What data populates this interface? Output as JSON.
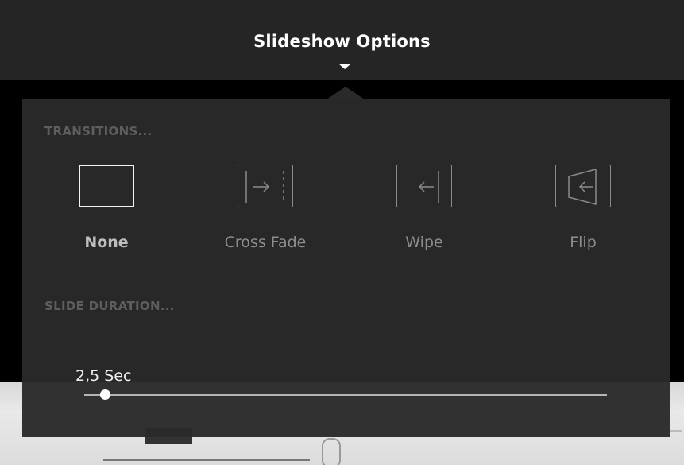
{
  "header": {
    "title": "Slideshow Options"
  },
  "transitions": {
    "section_label": "TRANSITIONS...",
    "selected": "None",
    "items": [
      {
        "label": "None",
        "icon": "blank-icon"
      },
      {
        "label": "Cross Fade",
        "icon": "cross-fade-icon"
      },
      {
        "label": "Wipe",
        "icon": "wipe-icon"
      },
      {
        "label": "Flip",
        "icon": "flip-icon"
      }
    ]
  },
  "duration": {
    "section_label": "SLIDE DURATION...",
    "value_text": "2,5 Sec",
    "slider_fraction": 0.04
  },
  "colors": {
    "header_bg": "#252525",
    "panel_bg": "#2a2a2a",
    "accent": "#ffffff"
  }
}
